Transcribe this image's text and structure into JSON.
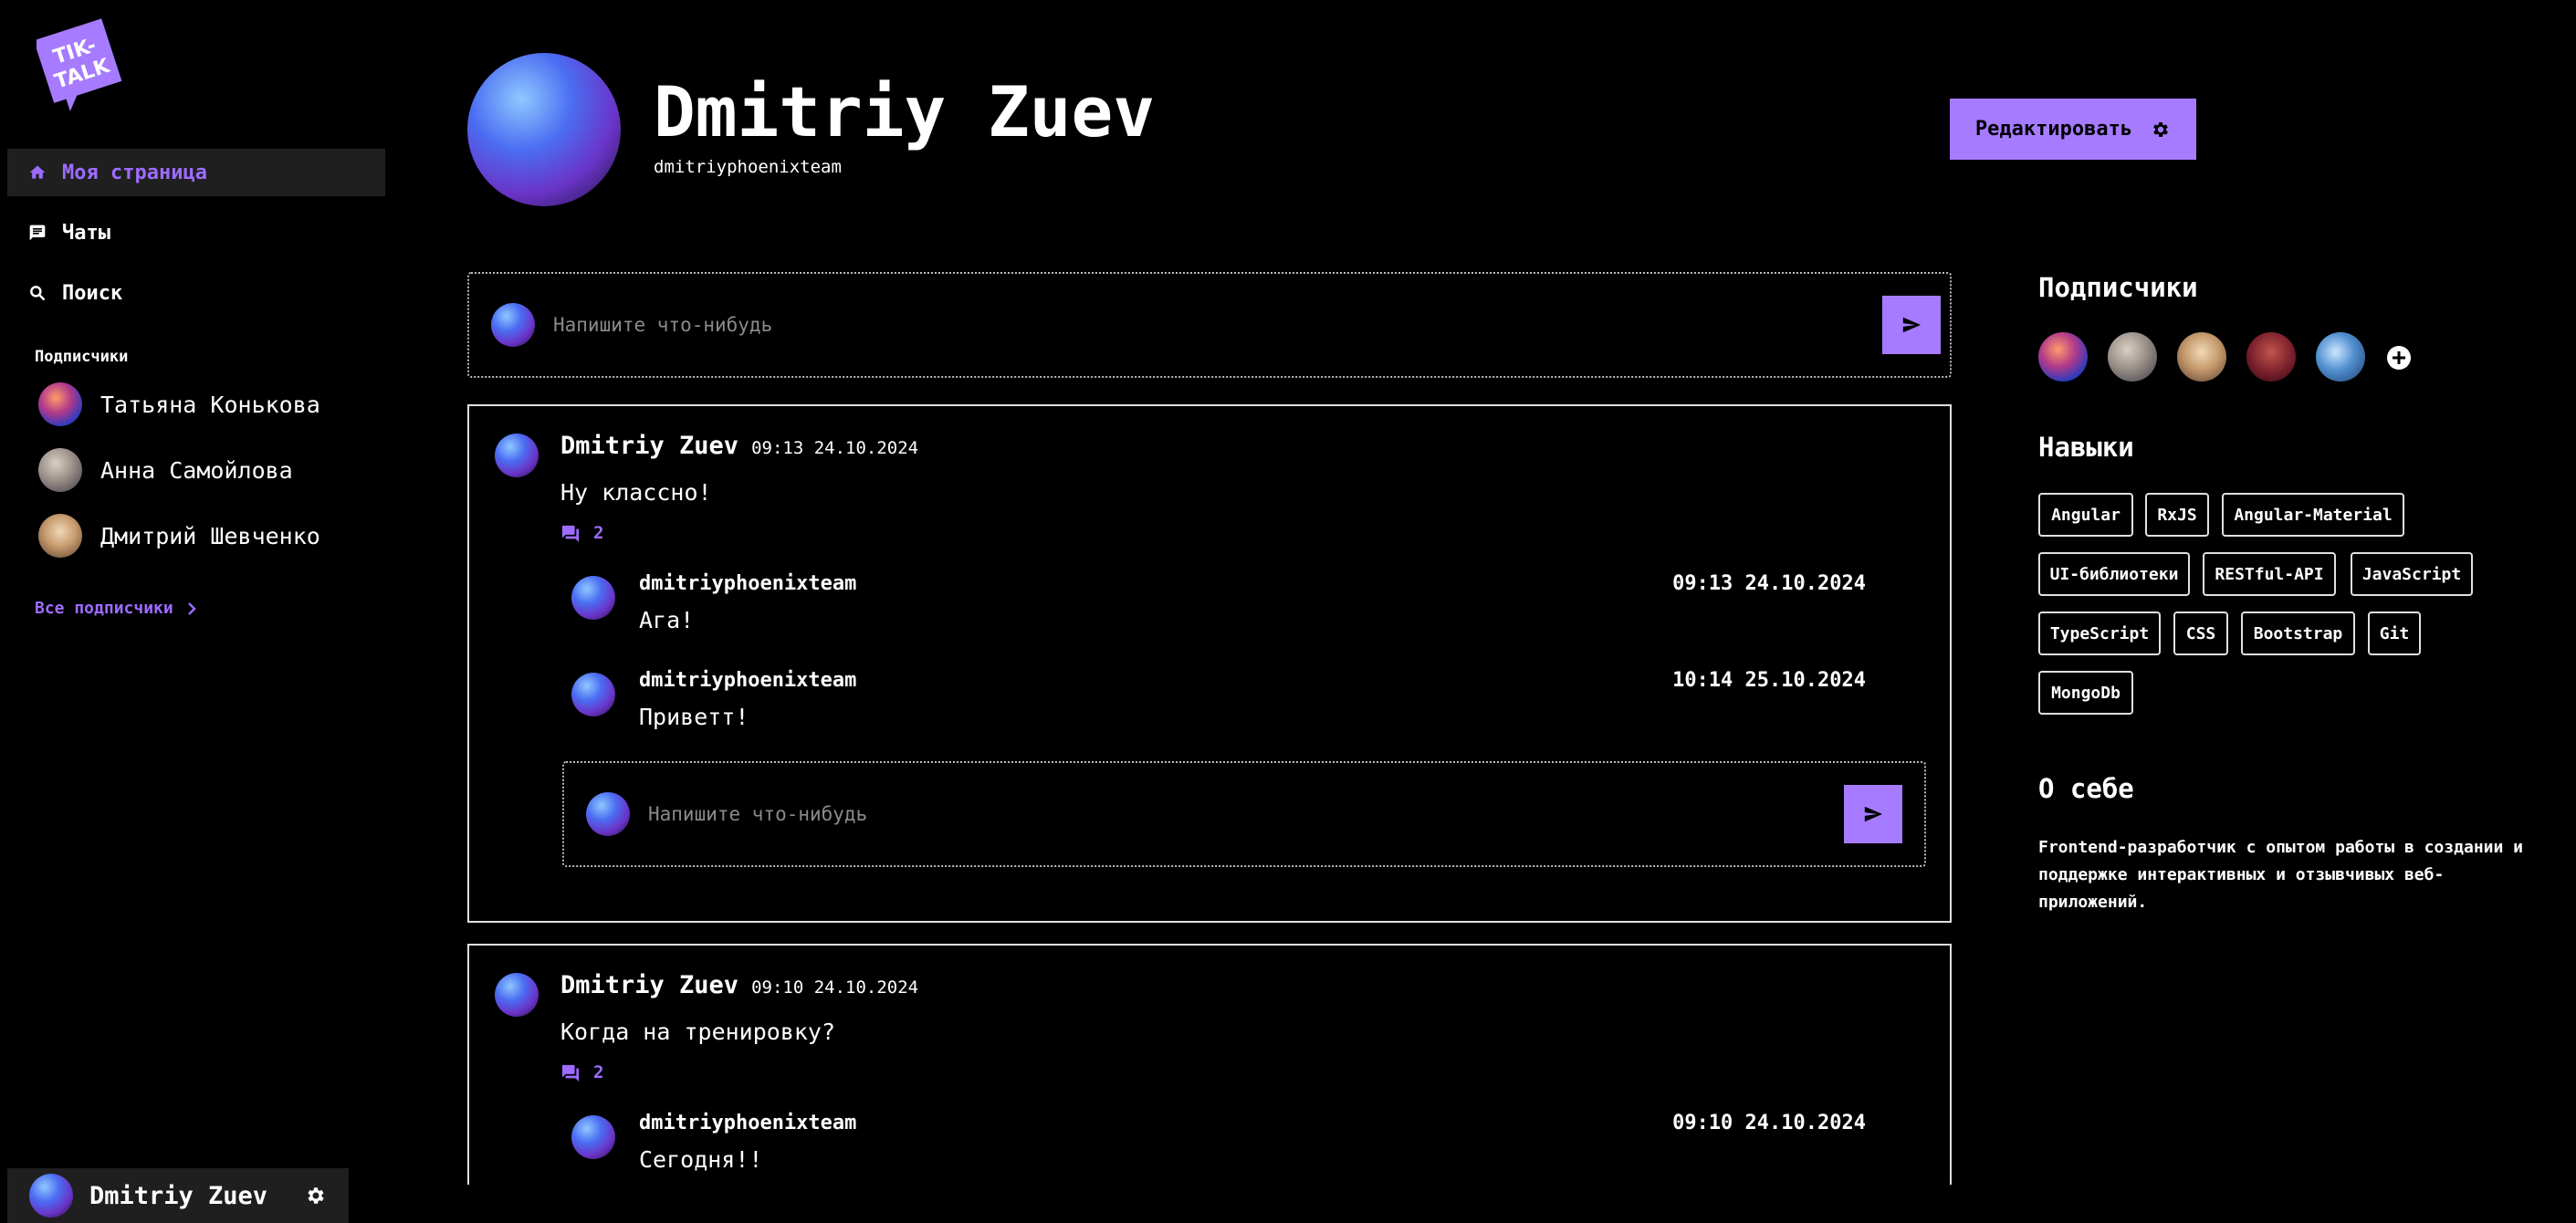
{
  "sidebar": {
    "logo_text": "TIK-TALK",
    "nav": [
      {
        "label": "Моя страница",
        "icon": "home-icon"
      },
      {
        "label": "Чаты",
        "icon": "chat-icon"
      },
      {
        "label": "Поиск",
        "icon": "search-icon"
      }
    ],
    "subscribers_title": "Подписчики",
    "subscribers": [
      {
        "name": "Татьяна Конькова"
      },
      {
        "name": "Анна Самойлова"
      },
      {
        "name": "Дмитрий Шевченко"
      }
    ],
    "all_subscribers_label": "Все подписчики",
    "me": {
      "name": "Dmitriy Zuev"
    }
  },
  "profile": {
    "name": "Dmitriy Zuev",
    "username": "dmitriyphoenixteam",
    "edit_label": "Редактировать"
  },
  "composer": {
    "placeholder": "Напишите что-нибудь"
  },
  "posts": [
    {
      "author": "Dmitriy Zuev",
      "date": "09:13 24.10.2024",
      "text": "Ну классно!",
      "comments_count": "2",
      "comments": [
        {
          "author": "dmitriyphoenixteam",
          "date": "09:13 24.10.2024",
          "text": "Ага!"
        },
        {
          "author": "dmitriyphoenixteam",
          "date": "10:14 25.10.2024",
          "text": "Приветт!"
        }
      ],
      "reply_placeholder": "Напишите что-нибудь"
    },
    {
      "author": "Dmitriy Zuev",
      "date": "09:10 24.10.2024",
      "text": "Когда на тренировку?",
      "comments_count": "2",
      "comments": [
        {
          "author": "dmitriyphoenixteam",
          "date": "09:10 24.10.2024",
          "text": "Сегодня!!"
        }
      ]
    }
  ],
  "right": {
    "followers_title": "Подписчики",
    "skills_title": "Навыки",
    "skills": [
      "Angular",
      "RxJS",
      "Angular-Material",
      "UI-библиотеки",
      "RESTful-API",
      "JavaScript",
      "TypeScript",
      "CSS",
      "Bootstrap",
      "Git",
      "MongoDb"
    ],
    "about_title": "О себе",
    "about_text": "Frontend-разработчик с опытом работы в создании и поддержке интерактивных и отзывчивых веб-приложений."
  },
  "colors": {
    "accent": "#a67bff",
    "background": "#000000",
    "panel": "#1f1f1f"
  }
}
